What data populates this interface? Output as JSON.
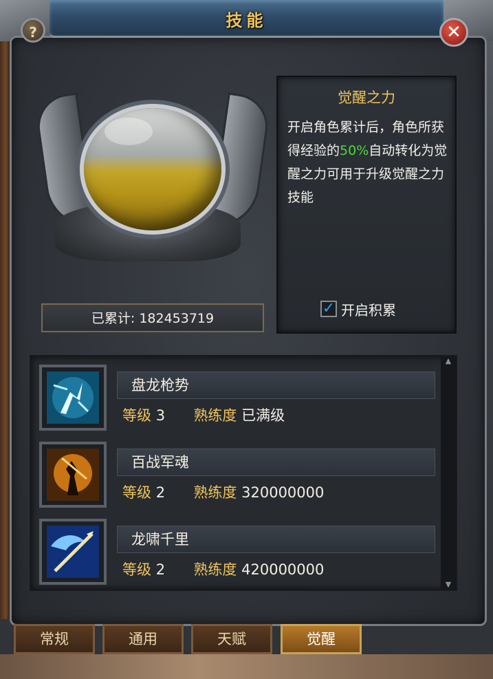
{
  "window": {
    "title": "技能",
    "help_label": "?",
    "close_label": "✕"
  },
  "orb": {
    "counter_text": "已累计: 182453719",
    "fill_fraction": 0.5
  },
  "description": {
    "title": "觉醒之力",
    "text_before": "开启角色累计后，角色所获得经验的",
    "highlight": "50%",
    "text_after": "自动转化为觉醒之力可用于升级觉醒之力技能",
    "highlight_color": "#4cdc3a"
  },
  "accumulate": {
    "label": "开启积累",
    "checked": true
  },
  "skills": [
    {
      "name": "盘龙枪势",
      "level_label": "等级",
      "level": "3",
      "prof_label": "熟练度",
      "prof": "已满级",
      "icon": "lightning-warrior-icon"
    },
    {
      "name": "百战军魂",
      "level_label": "等级",
      "level": "2",
      "prof_label": "熟练度",
      "prof": "320000000",
      "icon": "flaming-warrior-icon"
    },
    {
      "name": "龙啸千里",
      "level_label": "等级",
      "level": "2",
      "prof_label": "熟练度",
      "prof": "420000000",
      "icon": "dragon-spear-icon"
    }
  ],
  "tabs": [
    {
      "label": "常规",
      "active": false
    },
    {
      "label": "通用",
      "active": false
    },
    {
      "label": "天赋",
      "active": false
    },
    {
      "label": "觉醒",
      "active": true
    }
  ],
  "colors": {
    "gold_text": "#f0c45a",
    "active_tab": "#b57b2c"
  }
}
